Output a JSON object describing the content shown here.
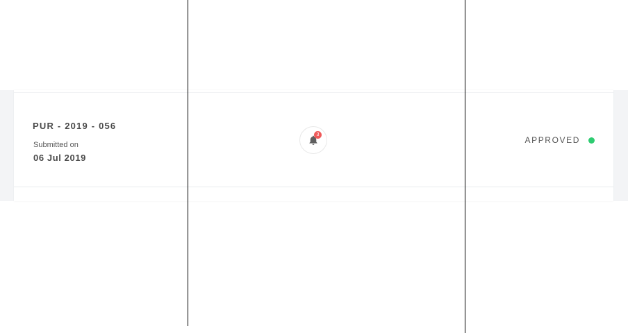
{
  "request": {
    "reference": "PUR - 2019 - 056",
    "submitted_label": "Submitted on",
    "submitted_date": "06 Jul 2019",
    "status": "APPROVED",
    "status_color": "#2ecc71"
  },
  "notifications": {
    "icon": "bell-icon",
    "count": "3",
    "badge_color": "#ef5a5a"
  }
}
